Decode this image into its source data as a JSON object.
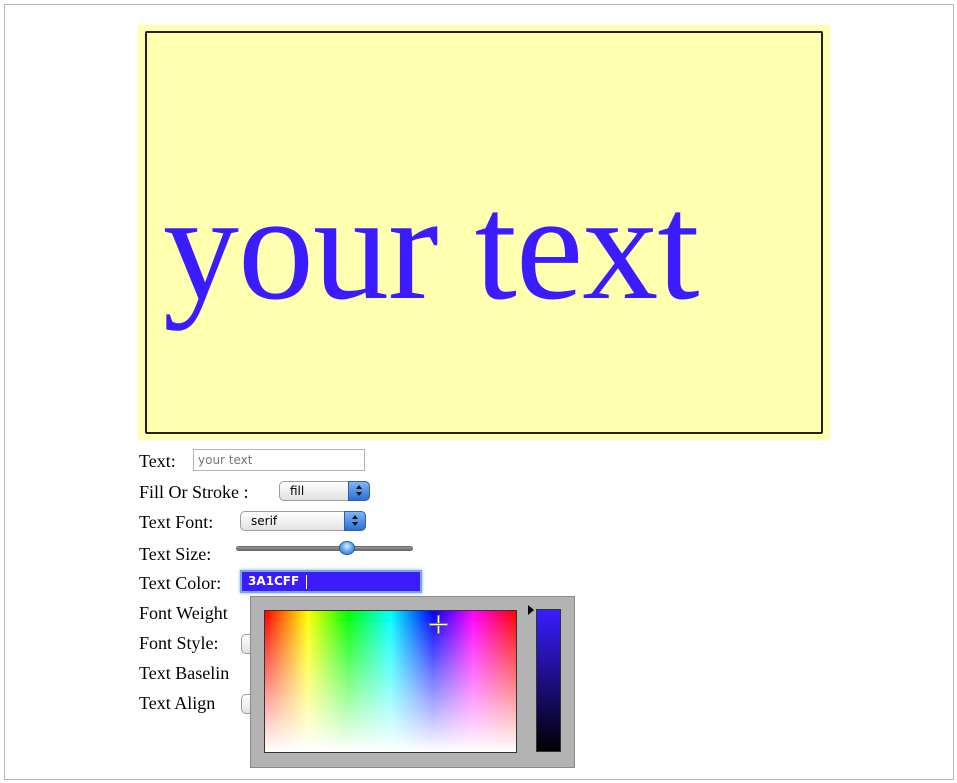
{
  "canvas": {
    "display_text": "your text",
    "background": "#ffffb0",
    "text_color": "#3a1cff"
  },
  "form": {
    "text_label": "Text:",
    "text_placeholder": "your text",
    "fill_stroke_label": "Fill Or Stroke :",
    "fill_stroke_value": "fill",
    "font_label": "Text Font:",
    "font_value": "serif",
    "size_label": "Text Size:",
    "size_level_fraction": 0.62,
    "color_label": "Text Color:",
    "color_value": "3A1CFF",
    "weight_label": "Font Weight",
    "style_label": "Font Style:",
    "baseline_label": "Text Baselin",
    "align_label": "Text Align"
  },
  "color_picker": {
    "selected_color": "#3a1cff"
  }
}
